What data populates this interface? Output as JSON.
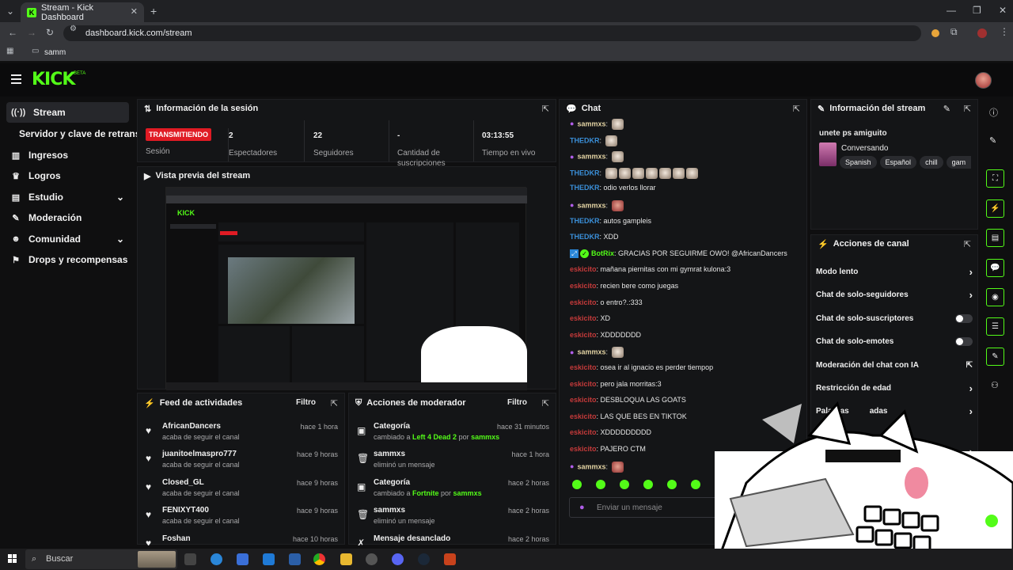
{
  "browser": {
    "tab_title": "Stream - Kick Dashboard",
    "url": "dashboard.kick.com/stream",
    "bookmark": "samm"
  },
  "kick": {
    "logo": "KICK",
    "beta": "BETA"
  },
  "sidebar": {
    "items": [
      {
        "label": "Stream",
        "icon": "broadcast-icon"
      },
      {
        "label": "Servidor y clave de retransmisión",
        "icon": ""
      },
      {
        "label": "Ingresos",
        "icon": "chart-icon"
      },
      {
        "label": "Logros",
        "icon": "trophy-icon"
      },
      {
        "label": "Estudio",
        "icon": "layout-icon"
      },
      {
        "label": "Moderación",
        "icon": "wrench-icon"
      },
      {
        "label": "Comunidad",
        "icon": "users-icon"
      },
      {
        "label": "Drops y recompensas",
        "icon": "gift-icon"
      }
    ]
  },
  "session": {
    "title": "Información de la sesión",
    "badge": "TRANSMITIENDO",
    "session_label": "Sesión",
    "viewers_value": "2",
    "viewers_label": "Espectadores",
    "followers_value": "22",
    "followers_label": "Seguidores",
    "subs_value": "-",
    "subs_label": "Cantidad de suscripciones",
    "uptime_value": "03:13:55",
    "uptime_label": "Tiempo en vivo"
  },
  "preview": {
    "title": "Vista previa del stream"
  },
  "activity": {
    "title": "Feed de actividades",
    "filter": "Filtro",
    "items": [
      {
        "name": "AfricanDancers",
        "sub": "acaba de seguir el canal",
        "time": "hace 1 hora"
      },
      {
        "name": "juanitoelmaspro777",
        "sub": "acaba de seguir el canal",
        "time": "hace 9 horas"
      },
      {
        "name": "Closed_GL",
        "sub": "acaba de seguir el canal",
        "time": "hace 9 horas"
      },
      {
        "name": "FENIXYT400",
        "sub": "acaba de seguir el canal",
        "time": "hace 9 horas"
      },
      {
        "name": "Foshan",
        "sub": "",
        "time": "hace 10 horas"
      }
    ]
  },
  "modactions": {
    "title": "Acciones de moderador",
    "filter": "Filtro",
    "items": [
      {
        "name": "Categoría",
        "pre": "cambiado a ",
        "hl": "Left 4 Dead 2",
        "mid": " por ",
        "who": "sammxs",
        "time": "hace 31 minutos"
      },
      {
        "name": "sammxs",
        "pre": "eliminó un mensaje",
        "hl": "",
        "mid": "",
        "who": "",
        "time": "hace 1 hora"
      },
      {
        "name": "Categoría",
        "pre": "cambiado a ",
        "hl": "Fortnite",
        "mid": " por ",
        "who": "sammxs",
        "time": "hace 2 horas"
      },
      {
        "name": "sammxs",
        "pre": "eliminó un mensaje",
        "hl": "",
        "mid": "",
        "who": "",
        "time": "hace 2 horas"
      },
      {
        "name": "Mensaje desanclado",
        "pre": "",
        "hl": "",
        "mid": "",
        "who": "",
        "time": "hace 2 horas"
      }
    ]
  },
  "chat": {
    "title": "Chat",
    "placeholder": "Enviar un mensaje",
    "messages": [
      {
        "user": "sammxs",
        "cls": "u-sammxs",
        "text": "",
        "emotes": 1,
        "mic": true
      },
      {
        "user": "THEDKR",
        "cls": "u-thedkr",
        "text": "",
        "emotes": 1,
        "mic": false
      },
      {
        "user": "sammxs",
        "cls": "u-sammxs",
        "text": "",
        "emotes": 1,
        "mic": true
      },
      {
        "user": "THEDKR",
        "cls": "u-thedkr",
        "text": "",
        "emotes": 7,
        "mic": false
      },
      {
        "user": "THEDKR",
        "cls": "u-thedkr",
        "text": "odio verlos llorar",
        "emotes": 0,
        "mic": false
      },
      {
        "user": "sammxs",
        "cls": "u-sammxs",
        "text": "",
        "emotes": 1,
        "mic": true,
        "red": true
      },
      {
        "user": "THEDKR",
        "cls": "u-thedkr",
        "text": "autos gampleis",
        "emotes": 0,
        "mic": false
      },
      {
        "user": "THEDKR",
        "cls": "u-thedkr",
        "text": "XDD",
        "emotes": 0,
        "mic": false
      },
      {
        "user": "BotRix",
        "cls": "u-botrix",
        "text": "GRACIAS POR SEGUIRME OWO! @AfricanDancers",
        "emotes": 0,
        "mic": false,
        "bot": true
      },
      {
        "user": "eskicito",
        "cls": "u-eskicito",
        "text": "mañana piernitas con mi gymrat kulona:3",
        "emotes": 0,
        "mic": false
      },
      {
        "user": "eskicito",
        "cls": "u-eskicito",
        "text": "recien bere como juegas",
        "emotes": 0,
        "mic": false
      },
      {
        "user": "eskicito",
        "cls": "u-eskicito",
        "text": "o entro?.:333",
        "emotes": 0,
        "mic": false
      },
      {
        "user": "eskicito",
        "cls": "u-eskicito",
        "text": "XD",
        "emotes": 0,
        "mic": false
      },
      {
        "user": "eskicito",
        "cls": "u-eskicito",
        "text": "XDDDDDDD",
        "emotes": 0,
        "mic": false
      },
      {
        "user": "sammxs",
        "cls": "u-sammxs",
        "text": "",
        "emotes": 1,
        "mic": true
      },
      {
        "user": "eskicito",
        "cls": "u-eskicito",
        "text": "osea ir al ignacio es perder tiempop",
        "emotes": 0,
        "mic": false
      },
      {
        "user": "eskicito",
        "cls": "u-eskicito",
        "text": "pero jala morritas:3",
        "emotes": 0,
        "mic": false
      },
      {
        "user": "eskicito",
        "cls": "u-eskicito",
        "text": "DESBLOQUA LAS GOATS",
        "emotes": 0,
        "mic": false
      },
      {
        "user": "eskicito",
        "cls": "u-eskicito",
        "text": "LAS QUE BES EN TIKTOK",
        "emotes": 0,
        "mic": false
      },
      {
        "user": "eskicito",
        "cls": "u-eskicito",
        "text": "XDDDDDDDDD",
        "emotes": 0,
        "mic": false
      },
      {
        "user": "eskicito",
        "cls": "u-eskicito",
        "text": "PAJERO CTM",
        "emotes": 0,
        "mic": false
      },
      {
        "user": "sammxs",
        "cls": "u-sammxs",
        "text": "",
        "emotes": 1,
        "mic": true,
        "red": true
      }
    ]
  },
  "streaminfo": {
    "title": "Información del stream",
    "stream_title": "unete ps amiguito",
    "category": "Conversando",
    "tags": [
      "Spanish",
      "Español",
      "chill",
      "gam"
    ]
  },
  "channelactions": {
    "title": "Acciones de canal",
    "items": [
      {
        "label": "Modo lento",
        "ctl": "chev"
      },
      {
        "label": "Chat de solo-seguidores",
        "ctl": "chev"
      },
      {
        "label": "Chat de solo-suscriptores",
        "ctl": "toggle"
      },
      {
        "label": "Chat de solo-emotes",
        "ctl": "toggle"
      },
      {
        "label": "Moderación del chat con IA",
        "ctl": "ext"
      },
      {
        "label": "Restricción de edad",
        "ctl": "chev"
      },
      {
        "label": "Palabras",
        "suffix": "adas",
        "ctl": "chev"
      }
    ]
  },
  "taskbar": {
    "search": "Buscar"
  },
  "colors": {
    "kick_green": "#53fc18",
    "live_red": "#e01b24",
    "panel": "#141517"
  }
}
